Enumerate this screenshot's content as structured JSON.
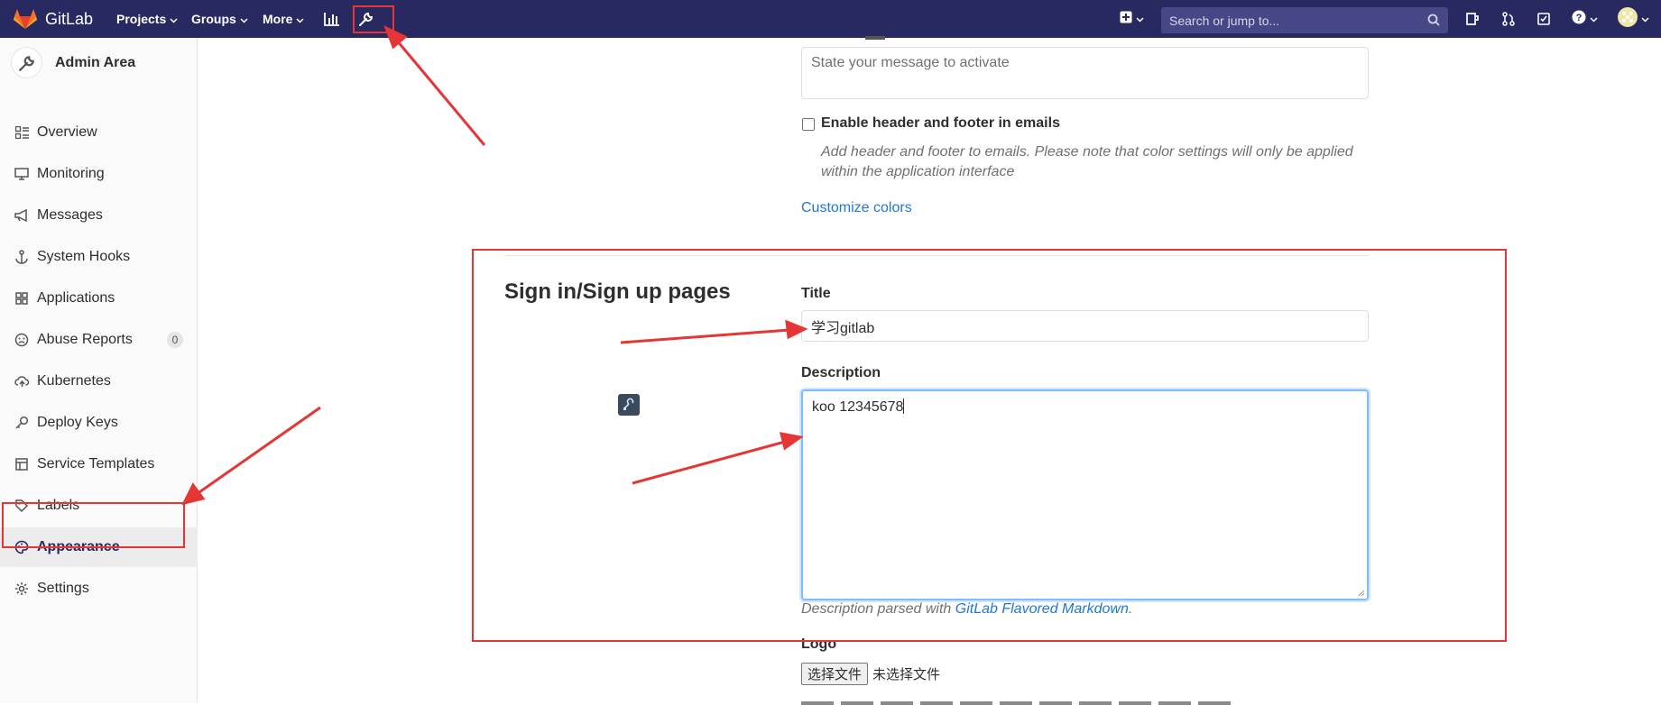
{
  "navbar": {
    "brand": "GitLab",
    "projects": "Projects",
    "groups": "Groups",
    "more": "More",
    "search_placeholder": "Search or jump to...",
    "icons": [
      "activity-chart-icon",
      "admin-wrench-icon",
      "plus-square-icon",
      "todo-icon",
      "merge-request-icon",
      "issues-check-icon",
      "help-icon",
      "user-avatar-icon"
    ]
  },
  "sidebar": {
    "title": "Admin Area",
    "items": [
      {
        "label": "Overview",
        "icon": "overview-icon"
      },
      {
        "label": "Monitoring",
        "icon": "monitor-icon"
      },
      {
        "label": "Messages",
        "icon": "megaphone-icon"
      },
      {
        "label": "System Hooks",
        "icon": "anchor-icon"
      },
      {
        "label": "Applications",
        "icon": "applications-grid-icon"
      },
      {
        "label": "Abuse Reports",
        "icon": "abuse-face-icon",
        "badge": "0"
      },
      {
        "label": "Kubernetes",
        "icon": "cloud-icon"
      },
      {
        "label": "Deploy Keys",
        "icon": "key-icon"
      },
      {
        "label": "Service Templates",
        "icon": "template-icon"
      },
      {
        "label": "Labels",
        "icon": "label-tag-icon"
      },
      {
        "label": "Appearance",
        "icon": "palette-icon",
        "active": true
      },
      {
        "label": "Settings",
        "icon": "settings-gear-icon"
      }
    ]
  },
  "main": {
    "message_placeholder": "State your message to activate",
    "email_checkbox_label": "Enable header and footer in emails",
    "email_help_line1": "Add header and footer to emails. Please note that color settings will only be applied",
    "email_help_line2": "within the application interface",
    "customize_colors": "Customize colors",
    "section_title": "Sign in/Sign up pages",
    "title_label": "Title",
    "title_value": "学习gitlab",
    "description_label": "Description",
    "description_value": "koo 12345678",
    "description_help_prefix": "Description parsed with ",
    "description_help_link": "GitLab Flavored Markdown",
    "description_help_suffix": ".",
    "logo_label": "Logo",
    "file_button": "选择文件",
    "file_none": "未选择文件"
  },
  "colors": {
    "navbar": "#292961",
    "annotation": "#e53535",
    "link": "#1f78d1"
  }
}
